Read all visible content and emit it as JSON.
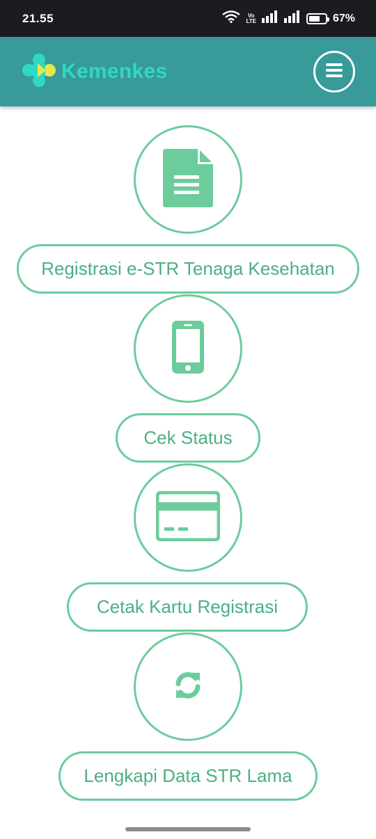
{
  "status_bar": {
    "time": "21.55",
    "volte_top": "Vo",
    "volte_bottom": "LTE",
    "battery": "67%",
    "battery_level": 0.67
  },
  "header": {
    "brand": "Kemenkes",
    "menu_icon": "hamburger-menu-icon"
  },
  "colors": {
    "header_bg": "#389a99",
    "brand_text": "#2fd8c4",
    "accent_green": "#6ccc9c",
    "label_green": "#4caf83"
  },
  "menu_items": [
    {
      "icon": "document-icon",
      "label": "Registrasi e-STR Tenaga Kesehatan"
    },
    {
      "icon": "smartphone-icon",
      "label": "Cek Status"
    },
    {
      "icon": "credit-card-icon",
      "label": "Cetak Kartu Registrasi"
    },
    {
      "icon": "refresh-icon",
      "label": "Lengkapi Data STR Lama"
    }
  ]
}
